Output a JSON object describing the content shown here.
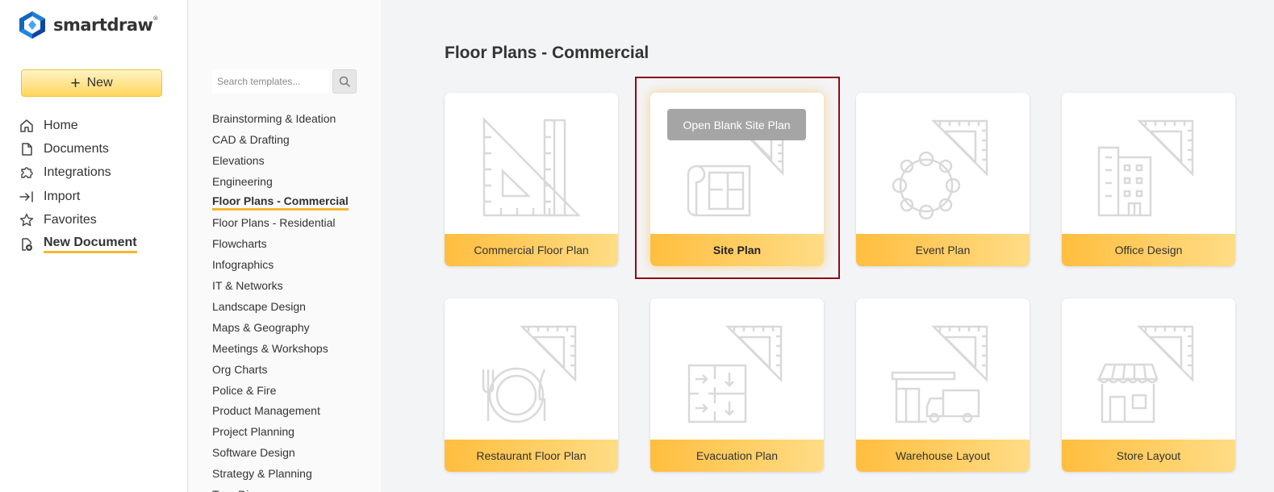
{
  "app": {
    "logo_text": "smartdraw",
    "brand_color": "#f5b731"
  },
  "sidebar": {
    "new_button": "New",
    "items": [
      {
        "label": "Home",
        "icon": "home-icon"
      },
      {
        "label": "Documents",
        "icon": "document-icon"
      },
      {
        "label": "Integrations",
        "icon": "puzzle-icon"
      },
      {
        "label": "Import",
        "icon": "import-icon"
      },
      {
        "label": "Favorites",
        "icon": "star-icon"
      },
      {
        "label": "New Document",
        "icon": "new-document-icon",
        "active": true
      }
    ]
  },
  "search": {
    "placeholder": "Search templates..."
  },
  "categories": [
    "Brainstorming & Ideation",
    "CAD & Drafting",
    "Elevations",
    "Engineering",
    "Floor Plans - Commercial",
    "Floor Plans - Residential",
    "Flowcharts",
    "Infographics",
    "IT & Networks",
    "Landscape Design",
    "Maps & Geography",
    "Meetings & Workshops",
    "Org Charts",
    "Police & Fire",
    "Product Management",
    "Project Planning",
    "Software Design",
    "Strategy & Planning",
    "Tree Diagrams"
  ],
  "active_category": "Floor Plans - Commercial",
  "main": {
    "title": "Floor Plans - Commercial",
    "open_blank_label": "Open Blank Site Plan",
    "templates": [
      {
        "label": "Commercial Floor Plan",
        "icon": "drafting-tools-icon"
      },
      {
        "label": "Site Plan",
        "icon": "blueprint-icon",
        "hovered": true
      },
      {
        "label": "Event Plan",
        "icon": "round-table-icon"
      },
      {
        "label": "Office Design",
        "icon": "office-building-icon"
      },
      {
        "label": "Restaurant Floor Plan",
        "icon": "plate-fork-knife-icon"
      },
      {
        "label": "Evacuation Plan",
        "icon": "evacuation-arrows-icon"
      },
      {
        "label": "Warehouse Layout",
        "icon": "warehouse-truck-icon"
      },
      {
        "label": "Store Layout",
        "icon": "storefront-icon"
      }
    ]
  }
}
